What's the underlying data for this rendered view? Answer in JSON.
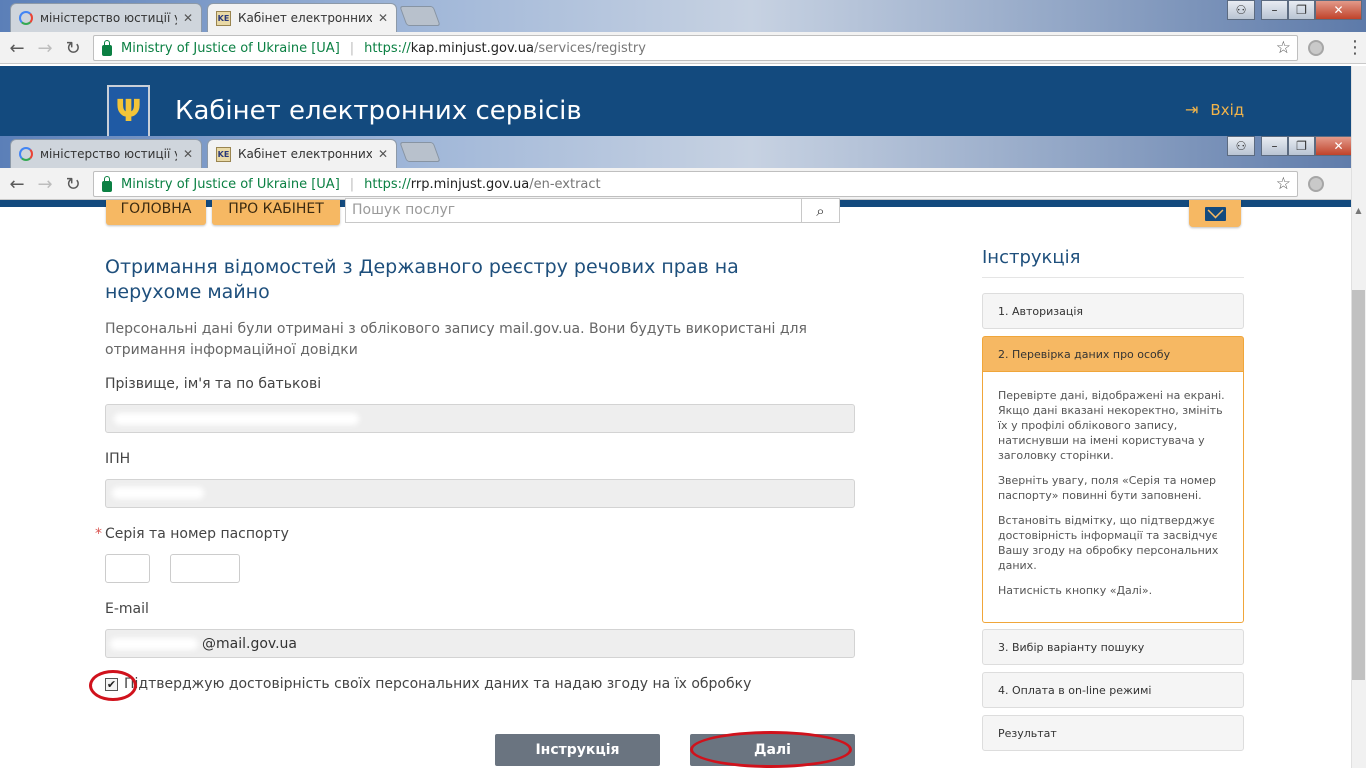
{
  "browser_top": {
    "tabs": [
      {
        "title": "міністерство юстиції укр",
        "favicon": "google"
      },
      {
        "title": "Кабінет електронних сер",
        "favicon": "kec",
        "active": true
      }
    ],
    "site_name": "Ministry of Justice of Ukraine [UA]",
    "url_scheme": "https://",
    "url_host": "kap.minjust.gov.ua",
    "url_path": "/services/registry"
  },
  "browser_second": {
    "tabs": [
      {
        "title": "міністерство юстиції укр",
        "favicon": "google"
      },
      {
        "title": "Кабінет електронних сер",
        "favicon": "kec",
        "active": true
      }
    ],
    "site_name": "Ministry of Justice of Ukraine [UA]",
    "url_scheme": "https://",
    "url_host": "rrp.minjust.gov.ua",
    "url_path": "/en-extract"
  },
  "site": {
    "title": "Кабінет електронних сервісів",
    "login": "Вхід",
    "coat_glyph": "Ψ"
  },
  "nav": {
    "home": "ГОЛОВНА",
    "about": "ПРО КАБІНЕТ",
    "search_placeholder": "Пошук послуг"
  },
  "form": {
    "heading": "Отримання відомостей з Державного реєстру речових прав на нерухоме майно",
    "info": "Персональні дані були отримані з облікового запису mail.gov.ua. Вони будуть використані для отримання інформаційної довідки",
    "name_label": "Прізвище, ім'я та по батькові",
    "ipn_label": "ІПН",
    "passport_label": "Серія та номер паспорту",
    "required_mark": "*",
    "email_label": "E-mail",
    "email_value": "@mail.gov.ua",
    "consent": "Підтверджую достовірність своїх персональних даних та надаю згоду на їх обробку",
    "consent_checked": true,
    "btn_instructions": "Інструкція",
    "btn_next": "Далі"
  },
  "instructions": {
    "title": "Інструкція",
    "steps": [
      "1. Авторизація",
      "2. Перевірка даних про особу",
      "3. Вибір варіанту пошуку",
      "4. Оплата в on-line режимі",
      "Результат"
    ],
    "active_step_paragraphs": [
      "Перевірте дані, відображені на екрані. Якщо дані вказані некоректно, змініть їх у профілі облікового запису, натиснувши на імені користувача у заголовку сторінки.",
      "Зверніть увагу, поля «Серія та номер паспорту» повинні бути заповнені.",
      "Встановіть відмітку, що підтверджує достовірність інформації та засвідчує Вашу згоду на обробку персональних даних.",
      "Натисність кнопку «Далі»."
    ]
  },
  "colors": {
    "header_blue": "#134a7e",
    "accent_orange": "#f6b863",
    "highlight_red": "#d0121c"
  }
}
